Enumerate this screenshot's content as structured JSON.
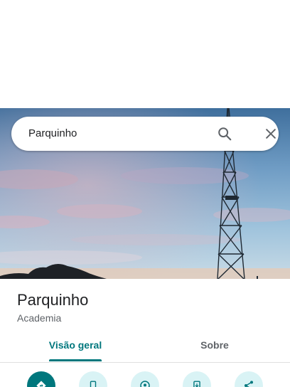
{
  "search": {
    "query": "Parquinho",
    "search_icon": "search-icon",
    "close_icon": "close-icon"
  },
  "place": {
    "title": "Parquinho",
    "category": "Academia"
  },
  "tabs": [
    {
      "label": "Visão geral",
      "active": true
    },
    {
      "label": "Sobre",
      "active": false
    }
  ],
  "actions": [
    {
      "icon": "directions-icon",
      "style": "primary"
    },
    {
      "icon": "phone-icon",
      "style": "secondary"
    },
    {
      "icon": "nearby-icon",
      "style": "secondary"
    },
    {
      "icon": "send-to-phone-icon",
      "style": "secondary"
    },
    {
      "icon": "share-icon",
      "style": "secondary"
    }
  ],
  "colors": {
    "accent": "#00777d",
    "accent_light": "#d9f3f5",
    "title_text": "#202124",
    "secondary_text": "#5f6368"
  }
}
